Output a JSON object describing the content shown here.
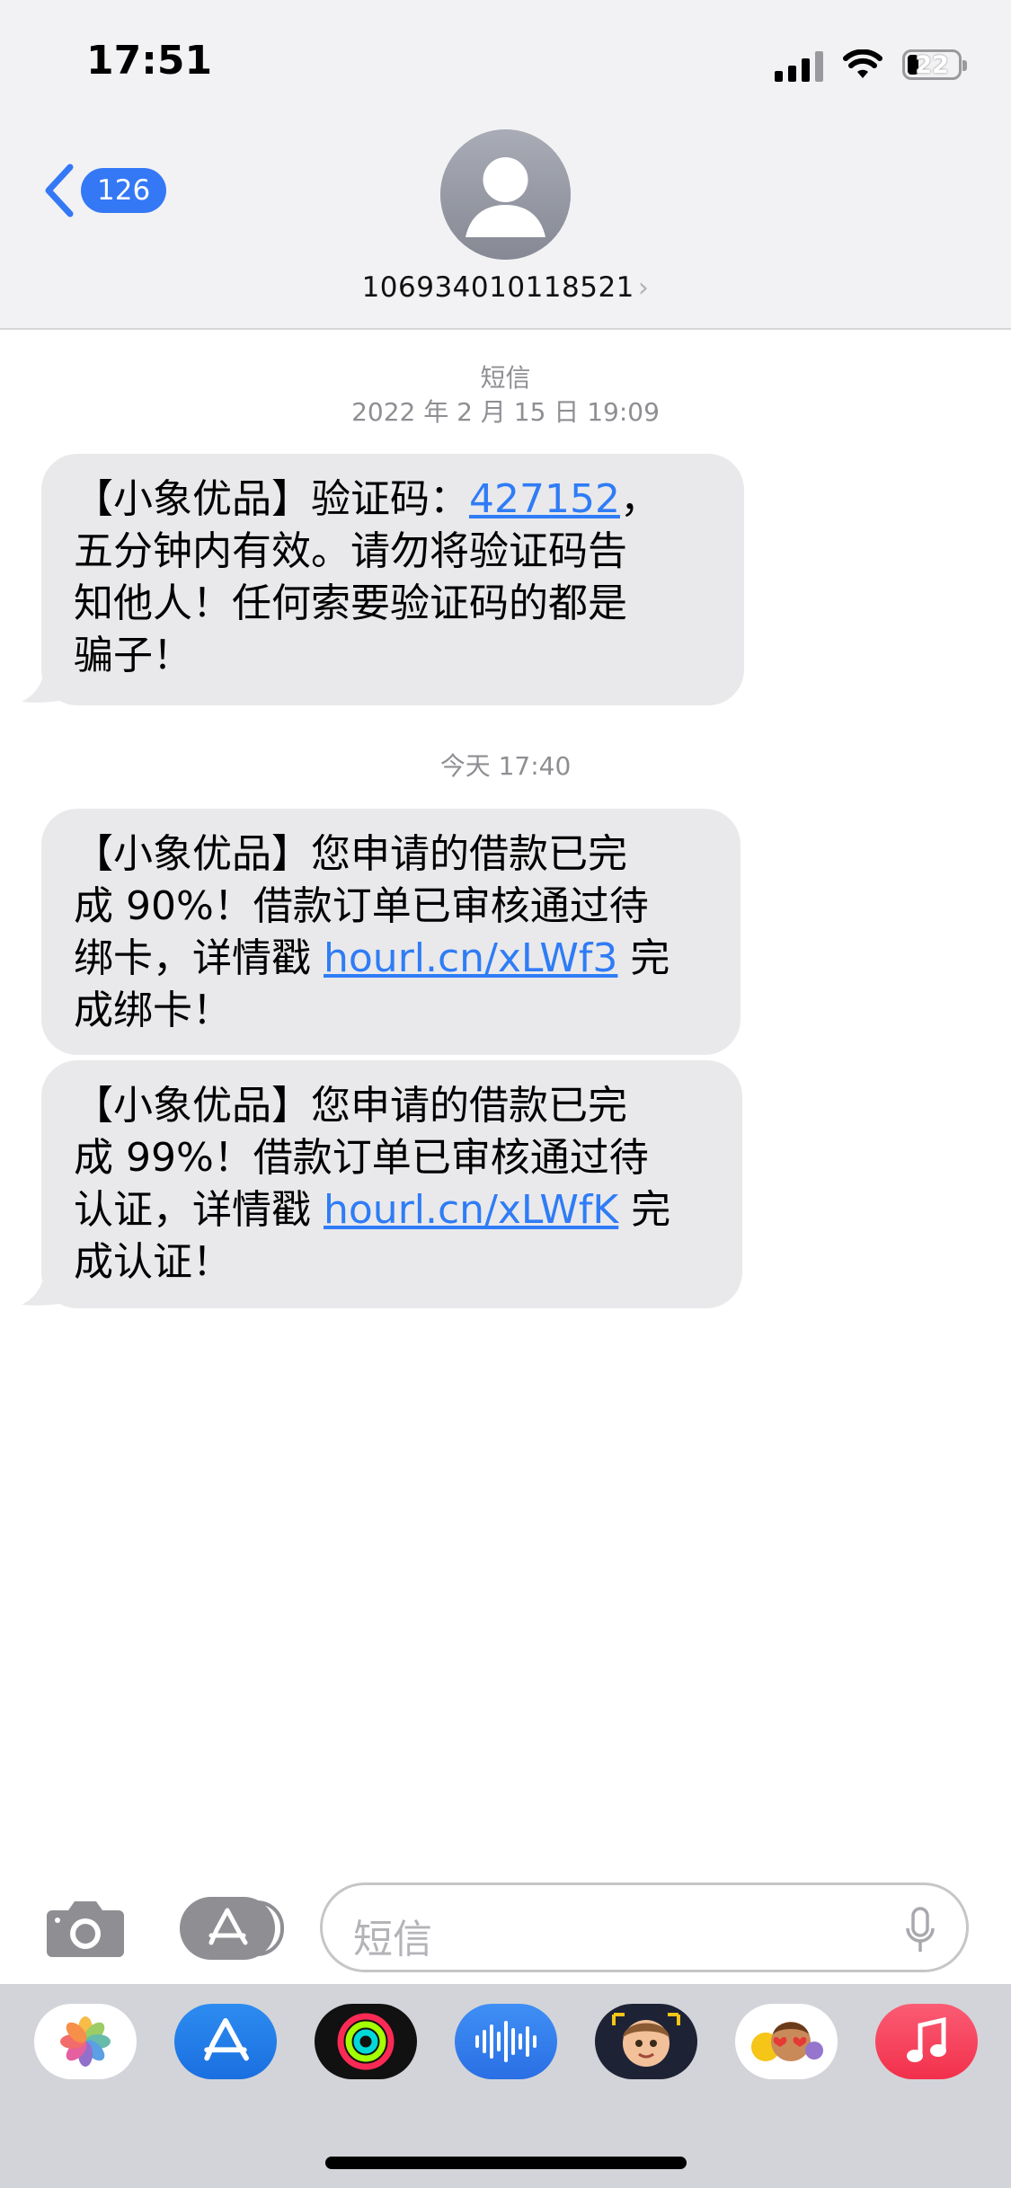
{
  "status_bar": {
    "time": "17:51",
    "battery": "22"
  },
  "header": {
    "back_count": "126",
    "contact": "106934010118521",
    "chevron": "›"
  },
  "conversation": {
    "stamp1": {
      "service": "短信",
      "datetime": "2022 年 2 月 15 日 19:09"
    },
    "message1": {
      "prefix": "【小象优品】验证码：",
      "code": "427152",
      "line1_end": "，",
      "line2": "五分钟内有效。请勿将验证码告",
      "line3": "知他人！任何索要验证码的都是",
      "line4": "骗子！"
    },
    "stamp2": {
      "datetime": "今天 17:40"
    },
    "message2": {
      "line1": "【小象优品】您申请的借款已完",
      "line2": "成 90%！借款订单已审核通过待",
      "line3_pre": "绑卡，详情戳 ",
      "link": "hourl.cn/xLWf3",
      "line3_post": " 完",
      "line4": "成绑卡！"
    },
    "message3": {
      "line1": "【小象优品】您申请的借款已完",
      "line2": "成 99%！借款订单已审核通过待",
      "line3_pre": "认证，详情戳 ",
      "link": "hourl.cn/xLWfK",
      "line3_post": " 完",
      "line4": "成认证！"
    }
  },
  "composer": {
    "placeholder": "短信"
  },
  "app_drawer": {
    "apps": [
      "photos-icon",
      "app-store-icon",
      "activity-icon",
      "audio-messages-icon",
      "memoji-icon",
      "animoji-stickers-icon",
      "music-icon"
    ]
  },
  "colors": {
    "accent": "#3478f6",
    "bubble": "#e9e9eb",
    "header_bg": "#f2f2f4",
    "drawer_bg": "#d3d4d9"
  }
}
